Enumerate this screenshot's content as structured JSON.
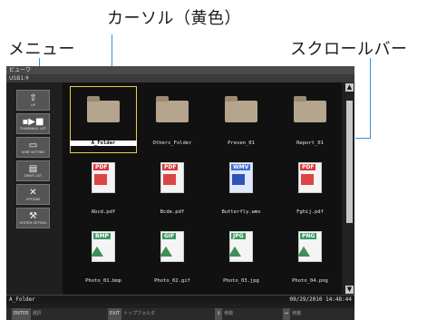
{
  "callouts": {
    "cursor": "カーソル（黄色）",
    "menu": "メニュー",
    "scrollbar": "スクロールバー"
  },
  "window": {
    "title": "ビューワ",
    "path": "USB1:¥",
    "status_left": "A_Folder",
    "status_right": "09/29/2010  14:48:44"
  },
  "menu": [
    {
      "icon": "up-icon",
      "label": "UP"
    },
    {
      "icon": "thumbnail-list-icon",
      "label": "THUMBNAIL LIST"
    },
    {
      "icon": "sort-setting-icon",
      "label": "SORT SETTING"
    },
    {
      "icon": "drive-list-icon",
      "label": "DRIVE LIST"
    },
    {
      "icon": "options-icon",
      "label": "OPTIONS"
    },
    {
      "icon": "system-setting-icon",
      "label": "SYSTEM SETTING"
    }
  ],
  "files": [
    {
      "name": "A_Folder",
      "type": "folder",
      "selected": true
    },
    {
      "name": "Others_Folder",
      "type": "folder",
      "selected": false
    },
    {
      "name": "Presen_01",
      "type": "folder",
      "selected": false
    },
    {
      "name": "Report_01",
      "type": "folder",
      "selected": false
    },
    {
      "name": "Abcd.pdf",
      "type": "pdf",
      "badge": "PDF",
      "selected": false
    },
    {
      "name": "Bcde.pdf",
      "type": "pdf",
      "badge": "PDF",
      "selected": false
    },
    {
      "name": "Butterfly.wmv",
      "type": "wmv",
      "badge": "WMV",
      "selected": false
    },
    {
      "name": "Fghij.pdf",
      "type": "pdf",
      "badge": "PDF",
      "selected": false
    },
    {
      "name": "Photo_01.bmp",
      "type": "image",
      "badge": "BMP",
      "selected": false
    },
    {
      "name": "Photo_02.gif",
      "type": "image",
      "badge": "GIF",
      "selected": false
    },
    {
      "name": "Photo_03.jpg",
      "type": "image",
      "badge": "JPG",
      "selected": false
    },
    {
      "name": "Photo_04.png",
      "type": "image",
      "badge": "PNG",
      "selected": false
    }
  ],
  "help": [
    {
      "key": "ENTER",
      "label": "選択"
    },
    {
      "key": "EXIT",
      "label": "トップフォルダ"
    },
    {
      "key": "↕",
      "label": "移動"
    },
    {
      "key": "↔",
      "label": "移動"
    }
  ],
  "colors": {
    "cursor": "#e5d24a",
    "callout_line": "#3a8fd6",
    "pdf": "#d93a3a",
    "wmv": "#3f6fd1",
    "image": "#3d9a63"
  }
}
